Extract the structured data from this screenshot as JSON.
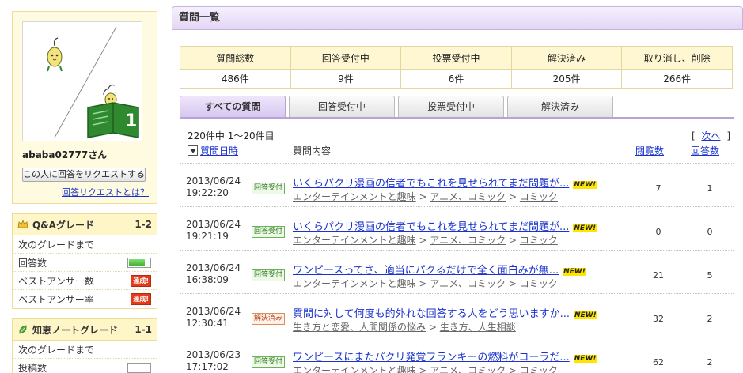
{
  "profile": {
    "name": "ababa02777さん",
    "request_button": "この人に回答をリクエストする",
    "request_help": "回答リクエストとは？",
    "avatar_badge": "1"
  },
  "qa_grade": {
    "title": "Q&Aグレード",
    "level": "1-2",
    "rows": [
      {
        "label": "次のグレードまで",
        "widget": "none"
      },
      {
        "label": "回答数",
        "widget": "meter",
        "progress": 0.75
      },
      {
        "label": "ベストアンサー数",
        "widget": "tag",
        "tag": "達成!"
      },
      {
        "label": "ベストアンサー率",
        "widget": "tag",
        "tag": "達成!"
      }
    ]
  },
  "note_grade": {
    "title": "知恵ノートグレード",
    "level": "1-1",
    "rows": [
      {
        "label": "次のグレードまで"
      },
      {
        "label": "投稿数"
      }
    ]
  },
  "page_title": "質問一覧",
  "stats": {
    "headers": [
      "質問総数",
      "回答受付中",
      "投票受付中",
      "解決済み",
      "取り消し、削除"
    ],
    "values": [
      "486件",
      "9件",
      "6件",
      "205件",
      "266件"
    ]
  },
  "tabs": [
    "すべての質問",
    "回答受付中",
    "投票受付中",
    "解決済み"
  ],
  "active_tab": 0,
  "count_text": "220件中 1～20件目",
  "next": {
    "open": "[",
    "label": "次へ",
    "close": "]"
  },
  "table_header": {
    "date": "質問日時",
    "content": "質問内容",
    "views": "閲覧数",
    "answers": "回答数"
  },
  "questions": [
    {
      "date": "2013/06/24",
      "time": "19:22:20",
      "status": "回答受付",
      "status_type": "open",
      "title": "いくらパクリ漫画の信者でもこれを見せられてまだ問題が...",
      "new": "NEW!",
      "category": [
        "エンターテインメントと趣味",
        "アニメ、コミック",
        "コミック"
      ],
      "views": "7",
      "answers": "1"
    },
    {
      "date": "2013/06/24",
      "time": "19:21:19",
      "status": "回答受付",
      "status_type": "open",
      "title": "いくらパクリ漫画の信者でもこれを見せられてまだ問題が...",
      "new": "NEW!",
      "category": [
        "エンターテインメントと趣味",
        "アニメ、コミック",
        "コミック"
      ],
      "views": "0",
      "answers": "0"
    },
    {
      "date": "2013/06/24",
      "time": "16:38:09",
      "status": "回答受付",
      "status_type": "open",
      "title": "ワンピースってさ、適当にパクるだけで全く面白みが無...",
      "new": "NEW!",
      "category": [
        "エンターテインメントと趣味",
        "アニメ、コミック",
        "コミック"
      ],
      "views": "21",
      "answers": "5"
    },
    {
      "date": "2013/06/24",
      "time": "12:30:41",
      "status": "解決済み",
      "status_type": "solved",
      "title": "質問に対して何度も的外れな回答する人をどう思いますか...",
      "new": "NEW!",
      "category": [
        "生き方と恋愛、人間関係の悩み",
        "生き方、人生相談"
      ],
      "views": "32",
      "answers": "2"
    },
    {
      "date": "2013/06/23",
      "time": "17:17:02",
      "status": "回答受付",
      "status_type": "open",
      "title": "ワンピースにまたパクリ発覚フランキーの燃料がコーラだ...",
      "new": "NEW!",
      "category": [
        "エンターテインメントと趣味",
        "アニメ、コミック",
        "コミック"
      ],
      "views": "62",
      "answers": "2"
    }
  ]
}
